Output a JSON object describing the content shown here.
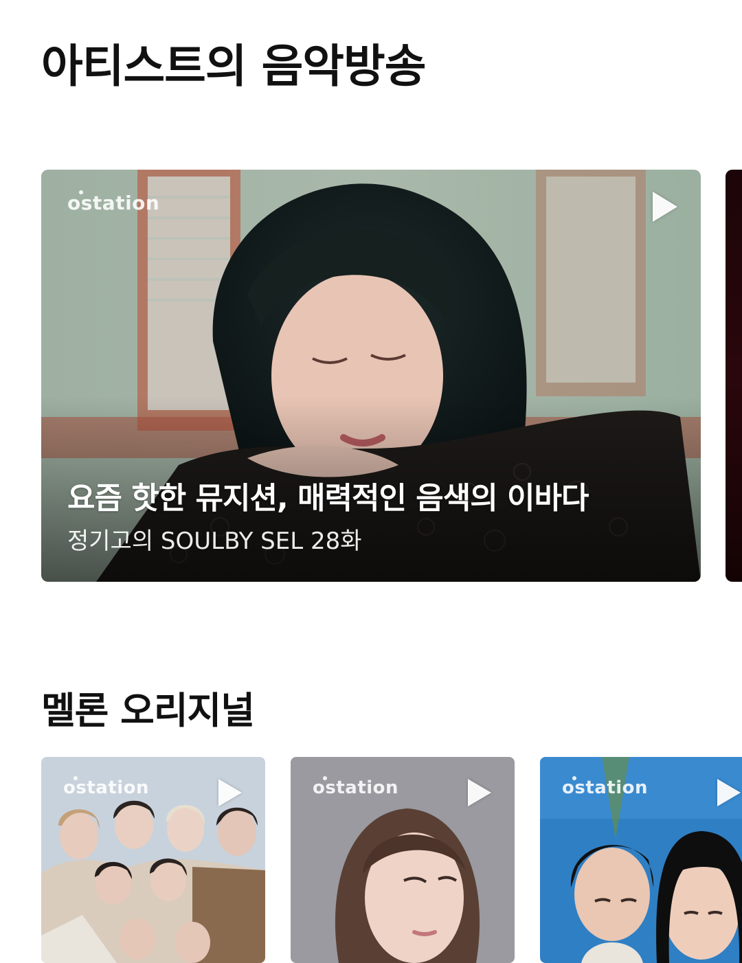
{
  "sections": {
    "featured_title": "아티스트의 음악방송",
    "original_title": "멜론 오리지널"
  },
  "featured": {
    "brand": "station",
    "title": "요즘 핫한 뮤지션, 매력적인 음색의 이바다",
    "subtitle": "정기고의 SOULBY SEL 28화"
  },
  "thumbnails": [
    {
      "brand": "station"
    },
    {
      "brand": "station"
    },
    {
      "brand": "station"
    }
  ],
  "colors": {
    "title_text": "#111111",
    "background": "#ffffff",
    "caption_text": "#ffffff"
  }
}
